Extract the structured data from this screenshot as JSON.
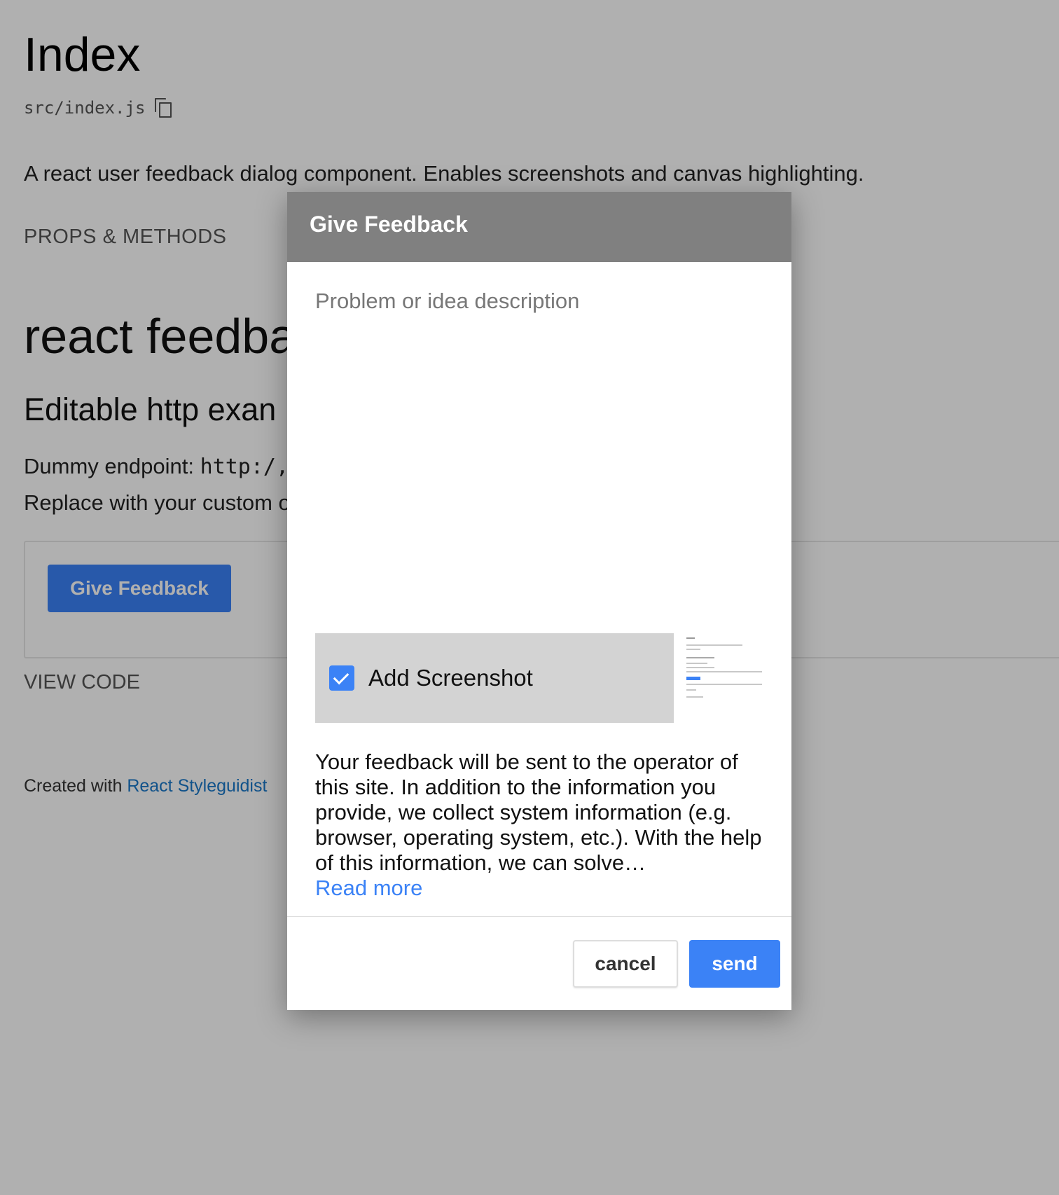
{
  "page": {
    "title": "Index",
    "path": "src/index.js",
    "description": "A react user feedback dialog component. Enables screenshots and canvas highlighting.",
    "props_link": "PROPS & METHODS",
    "heading": "react feedba",
    "subheading": "Editable http exan",
    "endpoint_label": "Dummy endpoint:",
    "endpoint_code": "http:/,",
    "replace_text": "Replace with your custom o",
    "example_button": "Give Feedback",
    "view_code": "VIEW CODE",
    "footer_prefix": "Created with",
    "footer_link": "React Styleguidist"
  },
  "dialog": {
    "title": "Give Feedback",
    "textarea_placeholder": "Problem or idea description",
    "screenshot_label": "Add Screenshot",
    "screenshot_checked": true,
    "privacy_text": "Your feedback will be sent to the operator of this site. In addition to the information you provide, we collect system information (e.g. browser, operating system, etc.). With the help of this information, we can solve…",
    "read_more": "Read more",
    "cancel_label": "cancel",
    "send_label": "send"
  },
  "colors": {
    "accent": "#3b82f6",
    "header_bg": "#808080",
    "screenshot_row_bg": "#d3d3d3",
    "link": "#1978c8"
  },
  "icons": {
    "copy": "copy-icon",
    "checkbox": "checkmark-icon"
  }
}
